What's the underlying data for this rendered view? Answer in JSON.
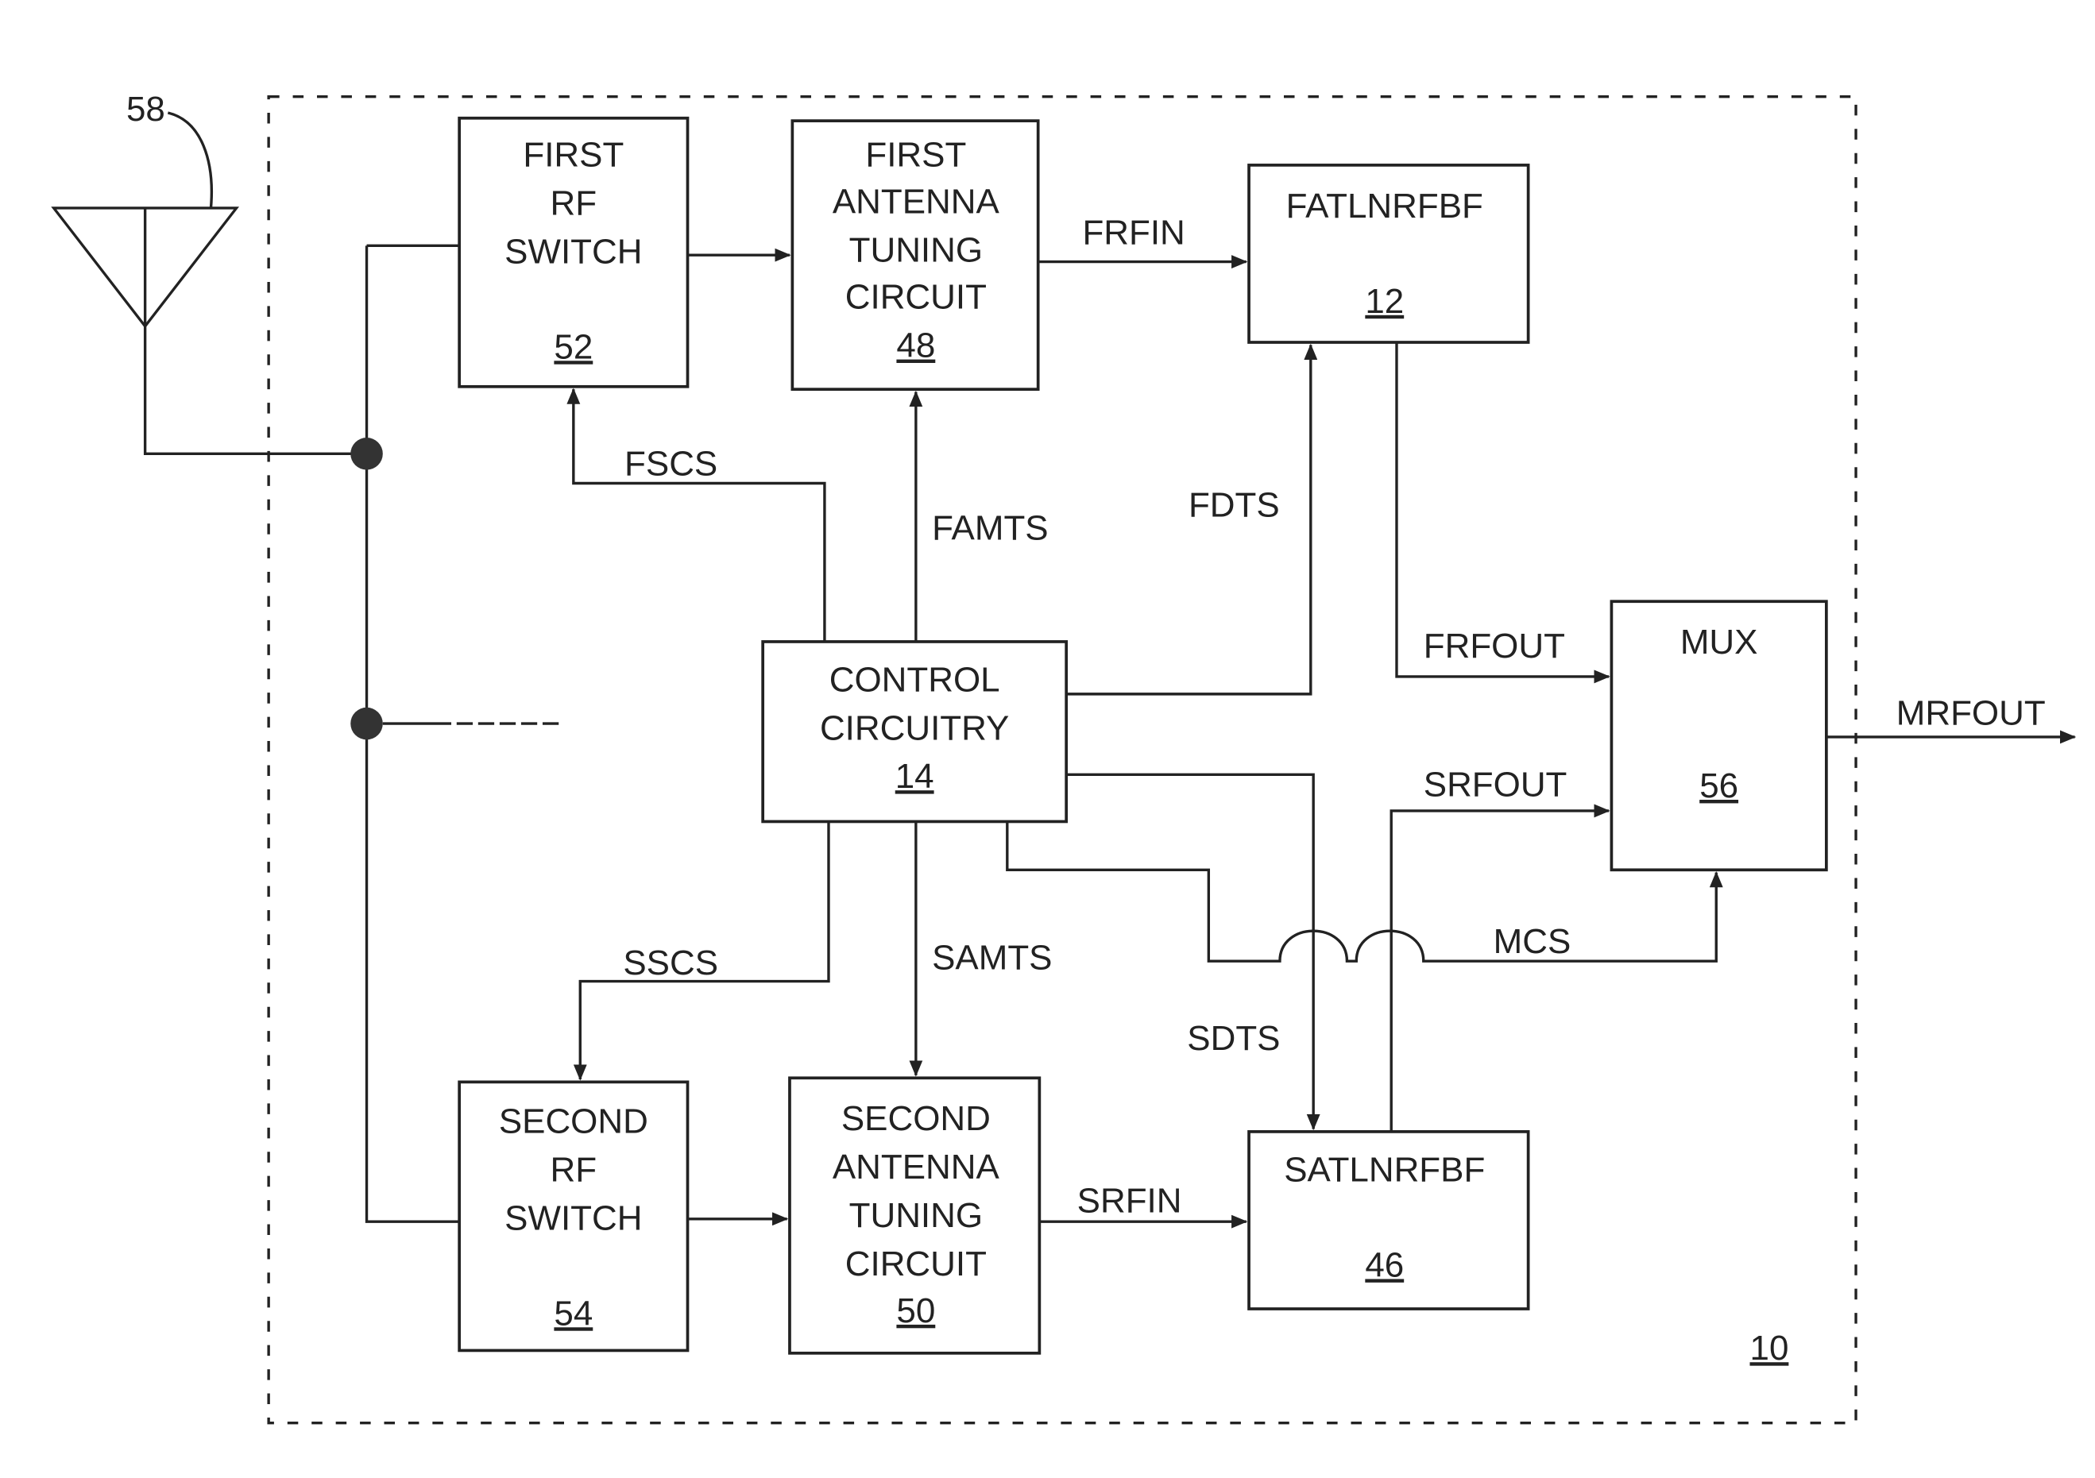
{
  "diagram": {
    "enclosure_ref": "10",
    "antenna_ref": "58",
    "blocks": {
      "first_rf_switch": {
        "lines": [
          "FIRST",
          "RF",
          "SWITCH"
        ],
        "ref": "52"
      },
      "first_tuning": {
        "lines": [
          "FIRST",
          "ANTENNA",
          "TUNING",
          "CIRCUIT"
        ],
        "ref": "48"
      },
      "fatlnrfbf": {
        "lines": [
          "FATLNRFBF"
        ],
        "ref": "12"
      },
      "control": {
        "lines": [
          "CONTROL",
          "CIRCUITRY"
        ],
        "ref": "14"
      },
      "mux": {
        "lines": [
          "MUX"
        ],
        "ref": "56"
      },
      "second_rf_switch": {
        "lines": [
          "SECOND",
          "RF",
          "SWITCH"
        ],
        "ref": "54"
      },
      "second_tuning": {
        "lines": [
          "SECOND",
          "ANTENNA",
          "TUNING",
          "CIRCUIT"
        ],
        "ref": "50"
      },
      "satlnrfbf": {
        "lines": [
          "SATLNRFBF"
        ],
        "ref": "46"
      }
    },
    "signals": {
      "frfin": "FRFIN",
      "fscs": "FSCS",
      "famts": "FAMTS",
      "fdts": "FDTS",
      "frfout": "FRFOUT",
      "mrfout": "MRFOUT",
      "srfout": "SRFOUT",
      "mcs": "MCS",
      "sscs": "SSCS",
      "samts": "SAMTS",
      "sdts": "SDTS",
      "srfin": "SRFIN"
    }
  }
}
